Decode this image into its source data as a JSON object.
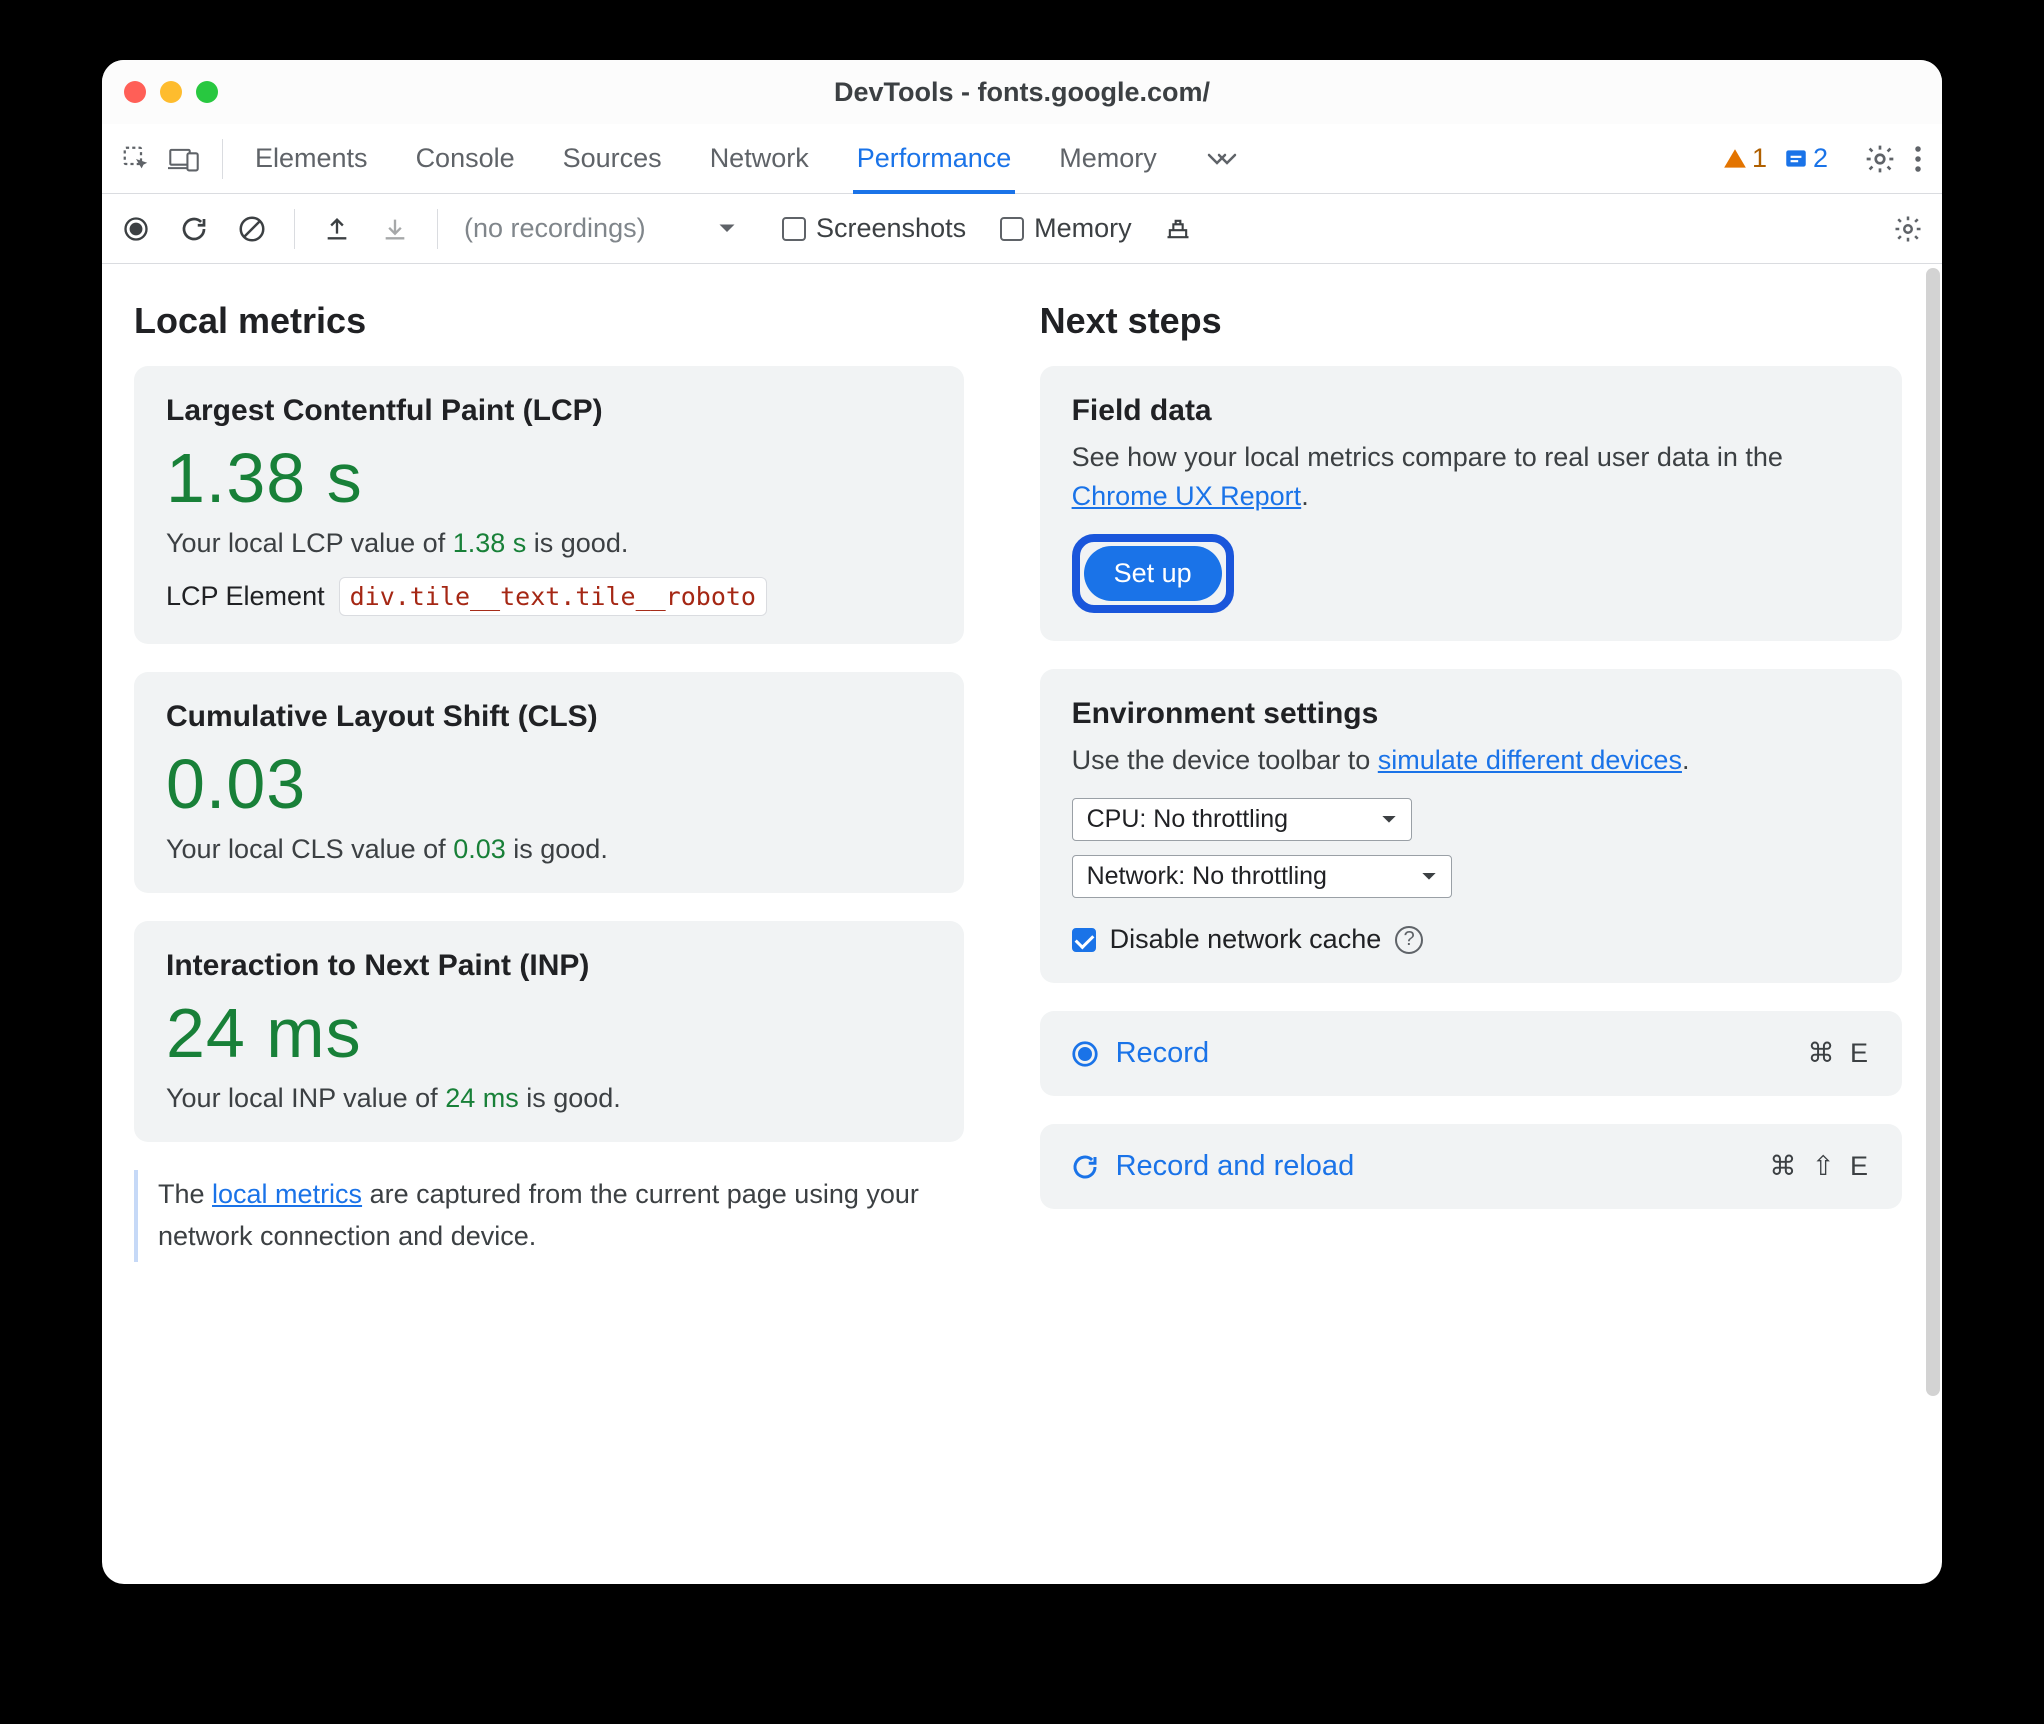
{
  "window": {
    "title": "DevTools - fonts.google.com/"
  },
  "tabs": {
    "items": [
      "Elements",
      "Console",
      "Sources",
      "Network",
      "Performance",
      "Memory"
    ],
    "active_index": 4,
    "warnings_count": "1",
    "issues_count": "2"
  },
  "toolbar": {
    "recordings_placeholder": "(no recordings)",
    "screenshots_label": "Screenshots",
    "memory_label": "Memory"
  },
  "local_metrics": {
    "heading": "Local metrics",
    "lcp": {
      "title": "Largest Contentful Paint (LCP)",
      "value": "1.38 s",
      "desc_prefix": "Your local LCP value of ",
      "desc_value": "1.38 s",
      "desc_suffix": " is good.",
      "element_label": "LCP Element",
      "element_value": "div.tile__text.tile__roboto"
    },
    "cls": {
      "title": "Cumulative Layout Shift (CLS)",
      "value": "0.03",
      "desc_prefix": "Your local CLS value of ",
      "desc_value": "0.03",
      "desc_suffix": " is good."
    },
    "inp": {
      "title": "Interaction to Next Paint (INP)",
      "value": "24 ms",
      "desc_prefix": "Your local INP value of ",
      "desc_value": "24 ms",
      "desc_suffix": " is good."
    },
    "note_prefix": "The ",
    "note_link": "local metrics",
    "note_suffix": " are captured from the current page using your network connection and device."
  },
  "next_steps": {
    "heading": "Next steps",
    "field_data": {
      "title": "Field data",
      "desc_prefix": "See how your local metrics compare to real user data in the ",
      "desc_link": "Chrome UX Report",
      "desc_suffix": ".",
      "button": "Set up"
    },
    "env": {
      "title": "Environment settings",
      "desc_prefix": "Use the device toolbar to ",
      "desc_link": "simulate different devices",
      "desc_suffix": ".",
      "cpu_select": "CPU: No throttling",
      "network_select": "Network: No throttling",
      "disable_cache_label": "Disable network cache"
    },
    "record": {
      "label": "Record",
      "shortcut": "⌘ E"
    },
    "record_reload": {
      "label": "Record and reload",
      "shortcut": "⌘ ⇧ E"
    }
  }
}
